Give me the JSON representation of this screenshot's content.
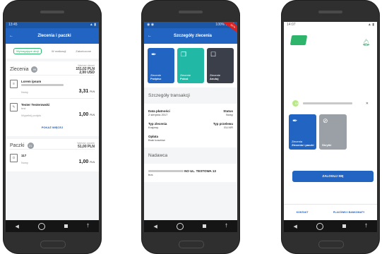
{
  "phone1": {
    "status_time": "13:45",
    "title": "Zlecenia i paczki",
    "filters": [
      "Wymagające akcji",
      "W realizacji",
      "Zakończone"
    ],
    "orders": {
      "title": "Zlecenia",
      "count": "99",
      "sum_label": "Wartość zleceń",
      "sum_pln": "151,02 PLN",
      "sum_usd": "2,00 USD",
      "items": [
        {
          "name": "Lorem ipsum",
          "status": "Nowy",
          "amount": "3,31",
          "currency": "PLN"
        },
        {
          "name": "Tester Testerowski",
          "sub": "test",
          "status": "Wypełnij podpis",
          "amount": "1,00",
          "currency": "PLN"
        }
      ],
      "more_label": "POKAŻ WIĘCEJ"
    },
    "packages": {
      "title": "Paczki",
      "count": "21",
      "sum_label": "Wartość paczek",
      "sum_pln": "51,00 PLN",
      "items": [
        {
          "name": "117",
          "status": "Nowy",
          "amount": "1,00",
          "currency": "PLN"
        }
      ]
    }
  },
  "phone2": {
    "status_time": "12:15",
    "status_right": "100%",
    "ribbon": "BETA",
    "title": "Szczegóły zlecenia",
    "cards": [
      {
        "small": "Zlecenie",
        "label": "Podpisz",
        "color": "#2164c1"
      },
      {
        "small": "Zlecenie",
        "label": "Pokaż",
        "color": "#21b8a6"
      },
      {
        "small": "Zlecenie",
        "label": "Anuluj",
        "color": "#3a3f4a"
      }
    ],
    "section_title": "Szczegóły transakcji",
    "rows": [
      {
        "left_label": "Data płatności",
        "left_value": "2 sierpnia 2017",
        "right_label": "Status",
        "right_value": "Nowy"
      },
      {
        "left_label": "Typ zlecenia",
        "left_value": "Krajowy",
        "right_label": "Typ przelewu",
        "right_value": "ELIXIR"
      },
      {
        "left_label": "Opłata",
        "left_value": "Brak kosztów",
        "right_label": "",
        "right_value": ""
      }
    ],
    "sender_title": "Nadawca",
    "sender_address": "NO UL. TESTOWA 13",
    "sender_sub": "bus"
  },
  "phone3": {
    "status_time": "14:07",
    "user_initials": "DS",
    "cards": [
      {
        "small": "Zlecenia",
        "label": "Zlecenia i paczki",
        "color": "#2164c1"
      },
      {
        "small": "",
        "label": "Skrytki",
        "color": "#9aa0a6"
      }
    ],
    "login_label": "ZALOGUJ SIĘ",
    "footer": [
      "KONTAKT",
      "PLACÓWKI I BANKOMATY"
    ]
  }
}
